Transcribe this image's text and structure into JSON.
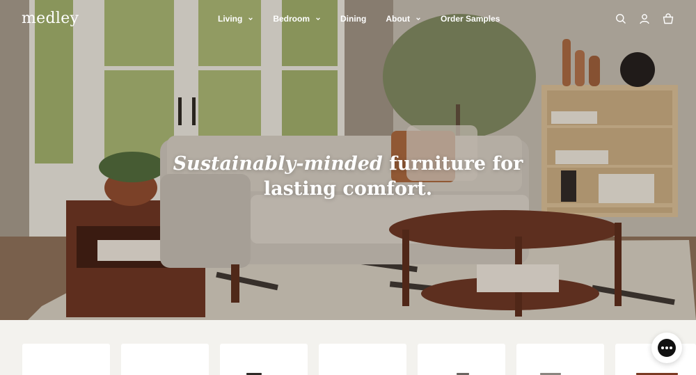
{
  "brand": {
    "logo_text": "medley"
  },
  "nav": {
    "items": [
      {
        "label": "Living",
        "has_dropdown": true
      },
      {
        "label": "Bedroom",
        "has_dropdown": true
      },
      {
        "label": "Dining",
        "has_dropdown": false
      },
      {
        "label": "About",
        "has_dropdown": true
      },
      {
        "label": "Order Samples",
        "has_dropdown": false
      }
    ]
  },
  "header_icons": [
    "search-icon",
    "account-icon",
    "cart-icon"
  ],
  "hero": {
    "headline_italic": "Sustainably-minded",
    "headline_rest": " furniture for",
    "headline_line2": "lasting comfort."
  },
  "chat_widget": {
    "icon": "chat-icon"
  },
  "colors": {
    "text_on_hero": "#ffffff",
    "page_background": "#f3f2ee",
    "card_background": "#ffffff"
  }
}
